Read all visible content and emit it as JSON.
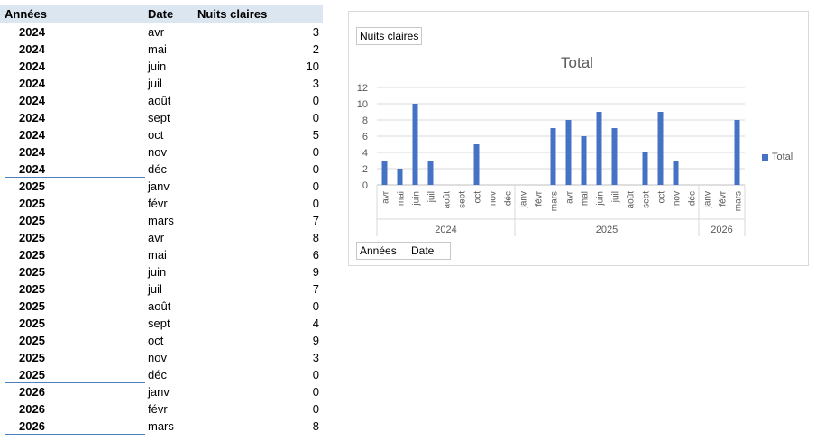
{
  "pivot": {
    "headers": {
      "years": "Années",
      "date": "Date",
      "value": "Nuits claires"
    },
    "rows": [
      {
        "year": "2024",
        "month": "avr",
        "value": "3"
      },
      {
        "year": "2024",
        "month": "mai",
        "value": "2"
      },
      {
        "year": "2024",
        "month": "juin",
        "value": "10"
      },
      {
        "year": "2024",
        "month": "juil",
        "value": "3"
      },
      {
        "year": "2024",
        "month": "août",
        "value": "0"
      },
      {
        "year": "2024",
        "month": "sept",
        "value": "0"
      },
      {
        "year": "2024",
        "month": "oct",
        "value": "5"
      },
      {
        "year": "2024",
        "month": "nov",
        "value": "0"
      },
      {
        "year": "2024",
        "month": "déc",
        "value": "0"
      },
      {
        "year": "2025",
        "month": "janv",
        "value": "0"
      },
      {
        "year": "2025",
        "month": "févr",
        "value": "0"
      },
      {
        "year": "2025",
        "month": "mars",
        "value": "7"
      },
      {
        "year": "2025",
        "month": "avr",
        "value": "8"
      },
      {
        "year": "2025",
        "month": "mai",
        "value": "6"
      },
      {
        "year": "2025",
        "month": "juin",
        "value": "9"
      },
      {
        "year": "2025",
        "month": "juil",
        "value": "7"
      },
      {
        "year": "2025",
        "month": "août",
        "value": "0"
      },
      {
        "year": "2025",
        "month": "sept",
        "value": "4"
      },
      {
        "year": "2025",
        "month": "oct",
        "value": "9"
      },
      {
        "year": "2025",
        "month": "nov",
        "value": "3"
      },
      {
        "year": "2025",
        "month": "déc",
        "value": "0"
      },
      {
        "year": "2026",
        "month": "janv",
        "value": "0"
      },
      {
        "year": "2026",
        "month": "févr",
        "value": "0"
      },
      {
        "year": "2026",
        "month": "mars",
        "value": "8"
      }
    ]
  },
  "chart_panel": {
    "value_field_button": "Nuits claires",
    "axis_field_buttons": [
      "Années",
      "Date"
    ]
  },
  "chart_data": {
    "type": "bar",
    "title": "Total",
    "legend_position": "right",
    "grid": true,
    "ylim": [
      0,
      12
    ],
    "yticks": [
      0,
      2,
      4,
      6,
      8,
      10,
      12
    ],
    "series": [
      {
        "name": "Total",
        "color": "#4472c4",
        "values": [
          3,
          2,
          10,
          3,
          0,
          0,
          5,
          0,
          0,
          0,
          0,
          7,
          8,
          6,
          9,
          7,
          0,
          4,
          9,
          3,
          0,
          0,
          0,
          8
        ]
      }
    ],
    "categories": [
      "avr",
      "mai",
      "juin",
      "juil",
      "août",
      "sept",
      "oct",
      "nov",
      "déc",
      "janv",
      "févr",
      "mars",
      "avr",
      "mai",
      "juin",
      "juil",
      "août",
      "sept",
      "oct",
      "nov",
      "déc",
      "janv",
      "févr",
      "mars"
    ],
    "groups": [
      {
        "label": "2024",
        "count": 9
      },
      {
        "label": "2025",
        "count": 12
      },
      {
        "label": "2026",
        "count": 3
      }
    ]
  }
}
